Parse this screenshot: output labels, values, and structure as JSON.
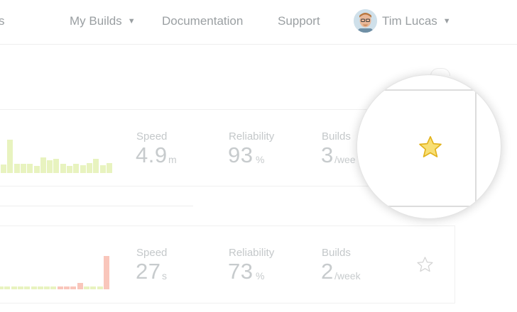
{
  "nav": {
    "partial_item": "s",
    "my_builds": "My Builds",
    "documentation": "Documentation",
    "support": "Support",
    "user_name": "Tim Lucas"
  },
  "pipelines": [
    {
      "speed_label": "Speed",
      "speed_value": "4.9",
      "speed_unit": "m",
      "reliability_label": "Reliability",
      "reliability_value": "93",
      "reliability_unit": "%",
      "builds_label": "Builds",
      "builds_value": "3",
      "builds_unit": "/wee",
      "starred": true,
      "history": [
        {
          "level": 0.25,
          "status": "passed"
        },
        {
          "level": 0.98,
          "status": "passed"
        },
        {
          "level": 0.27,
          "status": "passed"
        },
        {
          "level": 0.27,
          "status": "passed"
        },
        {
          "level": 0.27,
          "status": "passed"
        },
        {
          "level": 0.2,
          "status": "passed"
        },
        {
          "level": 0.45,
          "status": "passed"
        },
        {
          "level": 0.37,
          "status": "passed"
        },
        {
          "level": 0.42,
          "status": "passed"
        },
        {
          "level": 0.27,
          "status": "passed"
        },
        {
          "level": 0.2,
          "status": "passed"
        },
        {
          "level": 0.27,
          "status": "passed"
        },
        {
          "level": 0.23,
          "status": "passed"
        },
        {
          "level": 0.3,
          "status": "passed"
        },
        {
          "level": 0.42,
          "status": "passed"
        },
        {
          "level": 0.23,
          "status": "passed"
        },
        {
          "level": 0.3,
          "status": "passed"
        }
      ]
    },
    {
      "speed_label": "Speed",
      "speed_value": "27",
      "speed_unit": "s",
      "reliability_label": "Reliability",
      "reliability_value": "73",
      "reliability_unit": "%",
      "builds_label": "Builds",
      "builds_value": "2",
      "builds_unit": "/week",
      "starred": false,
      "history": [
        {
          "level": 0.08,
          "status": "passed"
        },
        {
          "level": 0.08,
          "status": "passed"
        },
        {
          "level": 0.08,
          "status": "passed"
        },
        {
          "level": 0.08,
          "status": "passed"
        },
        {
          "level": 0.08,
          "status": "passed"
        },
        {
          "level": 0.08,
          "status": "passed"
        },
        {
          "level": 0.08,
          "status": "passed"
        },
        {
          "level": 0.08,
          "status": "passed"
        },
        {
          "level": 0.08,
          "status": "passed"
        },
        {
          "level": 0.08,
          "status": "failed"
        },
        {
          "level": 0.08,
          "status": "failed"
        },
        {
          "level": 0.08,
          "status": "failed"
        },
        {
          "level": 0.18,
          "status": "failed"
        },
        {
          "level": 0.08,
          "status": "passed"
        },
        {
          "level": 0.08,
          "status": "passed"
        },
        {
          "level": 0.08,
          "status": "passed"
        },
        {
          "level": 0.97,
          "status": "failed"
        }
      ]
    }
  ],
  "colors": {
    "passed": "#e8f3bf",
    "failed": "#f9c6bb",
    "star_fill": "#f8df74",
    "star_stroke": "#e2b21c",
    "star_outline": "#d4d4d4"
  },
  "icons": {
    "caret": "caret-down-icon",
    "star_filled": "star-filled-icon",
    "star_outline": "star-outline-icon"
  }
}
